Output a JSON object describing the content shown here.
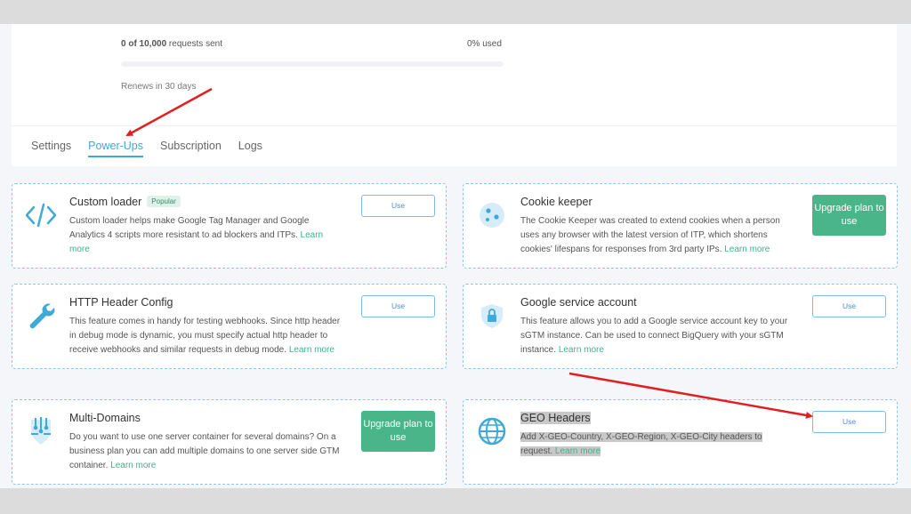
{
  "usage": {
    "requests_text": "0 of 10,000",
    "requests_suffix": " requests sent",
    "percent_text": "0% used",
    "progress_fraction": 0.0,
    "renews_text": "Renews in 30 days"
  },
  "tabs": [
    {
      "label": "Settings",
      "active": false
    },
    {
      "label": "Power-Ups",
      "active": true
    },
    {
      "label": "Subscription",
      "active": false
    },
    {
      "label": "Logs",
      "active": false
    }
  ],
  "cards": {
    "custom_loader": {
      "title": "Custom loader",
      "badge": "Popular",
      "desc": "Custom loader helps make Google Tag Manager and Google Analytics 4 scripts more resistant to ad blockers and ITPs. ",
      "learn": "Learn more",
      "button": "Use",
      "icon": "code-icon"
    },
    "cookie_keeper": {
      "title": "Cookie keeper",
      "desc": "The Cookie Keeper was created to extend cookies when a person uses any browser with the latest version of ITP, which shortens cookies' lifespans for responses from 3rd party IPs. ",
      "learn": "Learn more",
      "button": "Upgrade plan to use",
      "icon": "cookie-icon"
    },
    "http_header": {
      "title": "HTTP Header Config",
      "desc": "This feature comes in handy for testing webhooks. Since http header in debug mode is dynamic, you must specify actual http header to receive webhooks and similar requests in debug mode. ",
      "learn": "Learn more",
      "button": "Use",
      "icon": "wrench-icon"
    },
    "google_service": {
      "title": "Google service account",
      "desc": "This feature allows you to add a Google service account key to your sGTM instance. Can be used to connect BigQuery with your sGTM instance. ",
      "learn": "Learn more",
      "button": "Use",
      "icon": "shield-lock-icon"
    },
    "multi_domains": {
      "title": "Multi-Domains",
      "desc": "Do you want to use one server container for several domains? On a business plan you can add multiple domains to one server side GTM container. ",
      "learn": "Learn more",
      "button": "Upgrade plan to use",
      "icon": "brain-icon"
    },
    "geo_headers": {
      "title": "GEO Headers",
      "desc": "Add X-GEO-Country, X-GEO-Region, X-GEO-City headers to request. ",
      "learn": "Learn more",
      "button": "Use",
      "icon": "globe-icon"
    }
  },
  "colors": {
    "accent": "#3fa9d8",
    "green": "#4bb58a",
    "annotation_arrow": "#e02020"
  }
}
